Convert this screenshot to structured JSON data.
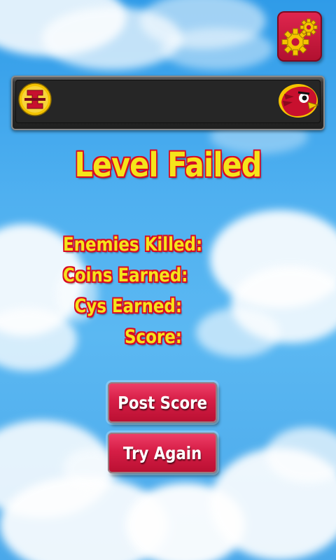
{
  "colors": {
    "sky": "#4fb0f0",
    "text_fill": "#f5e41a",
    "text_outline": "#d80a25",
    "button": "#d61e46",
    "bar": "#262626"
  },
  "settings": {
    "icon": "gears-icon"
  },
  "top_bar": {
    "left_logo": "iowa-state-i-logo",
    "right_logo": "cyclone-bird-logo"
  },
  "title": "Level Failed",
  "stats": {
    "enemies_killed_label": "Enemies Killed:",
    "coins_earned_label": "Coins Earned:",
    "cys_earned_label": "Cys Earned:",
    "score_label": "Score:"
  },
  "buttons": {
    "post_score": "Post Score",
    "try_again": "Try Again"
  }
}
